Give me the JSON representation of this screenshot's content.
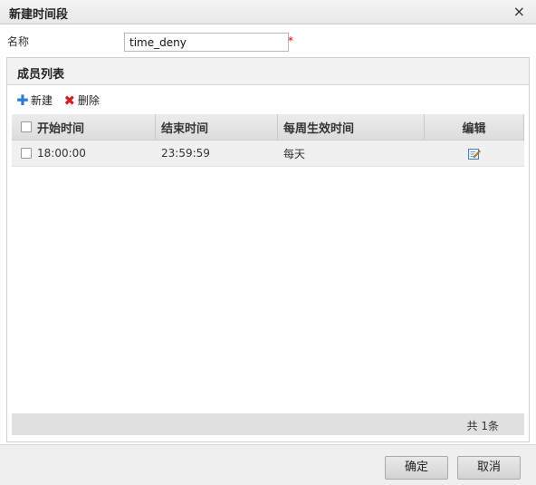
{
  "dialog": {
    "title": "新建时间段",
    "close_glyph": "×"
  },
  "form": {
    "name_label": "名称",
    "name_value": "time_deny",
    "required_mark": "*"
  },
  "members": {
    "title": "成员列表",
    "toolbar": {
      "new_label": "新建",
      "delete_label": "删除"
    },
    "columns": [
      "开始时间",
      "结束时间",
      "每周生效时间",
      "编辑"
    ],
    "rows": [
      {
        "start": "18:00:00",
        "end": "23:59:59",
        "week": "每天"
      }
    ],
    "count": "共 1条"
  },
  "buttons": {
    "ok": "确定",
    "cancel": "取消"
  },
  "icons": {
    "new": "plus-icon",
    "delete": "x-icon",
    "edit": "edit-icon",
    "close": "close-icon"
  },
  "colors": {
    "required": "#dd0000",
    "plus": "#2a7ad2",
    "delete": "#d02020"
  }
}
